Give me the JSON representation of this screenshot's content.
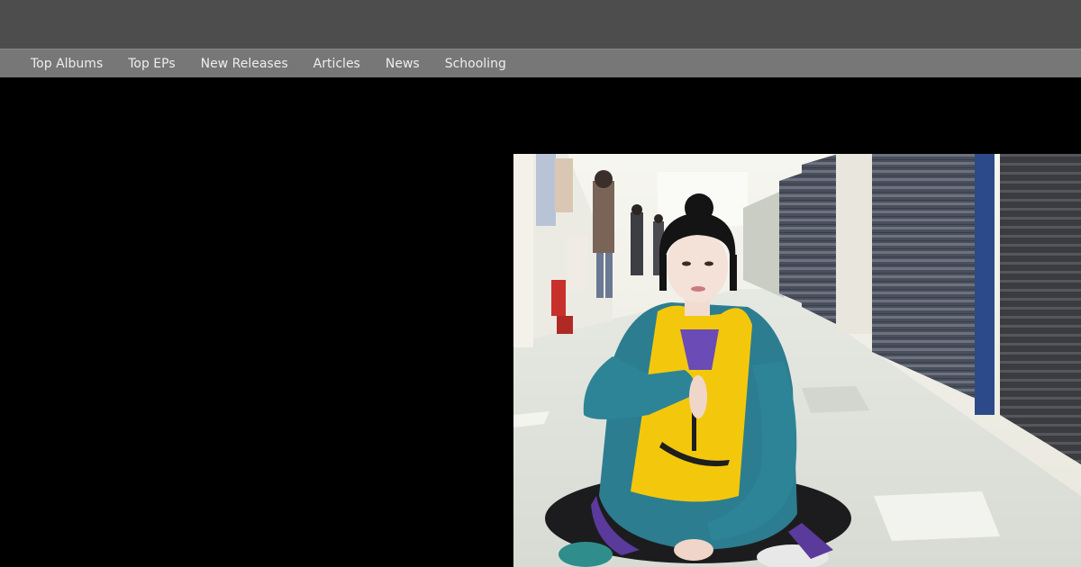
{
  "nav": {
    "items": [
      {
        "label": "Top Albums"
      },
      {
        "label": "Top EPs"
      },
      {
        "label": "New Releases"
      },
      {
        "label": "Articles"
      },
      {
        "label": "News"
      },
      {
        "label": "Schooling"
      }
    ]
  },
  "colors": {
    "topbar": "#4d4d4d",
    "navbar": "#777777",
    "background": "#000000"
  }
}
